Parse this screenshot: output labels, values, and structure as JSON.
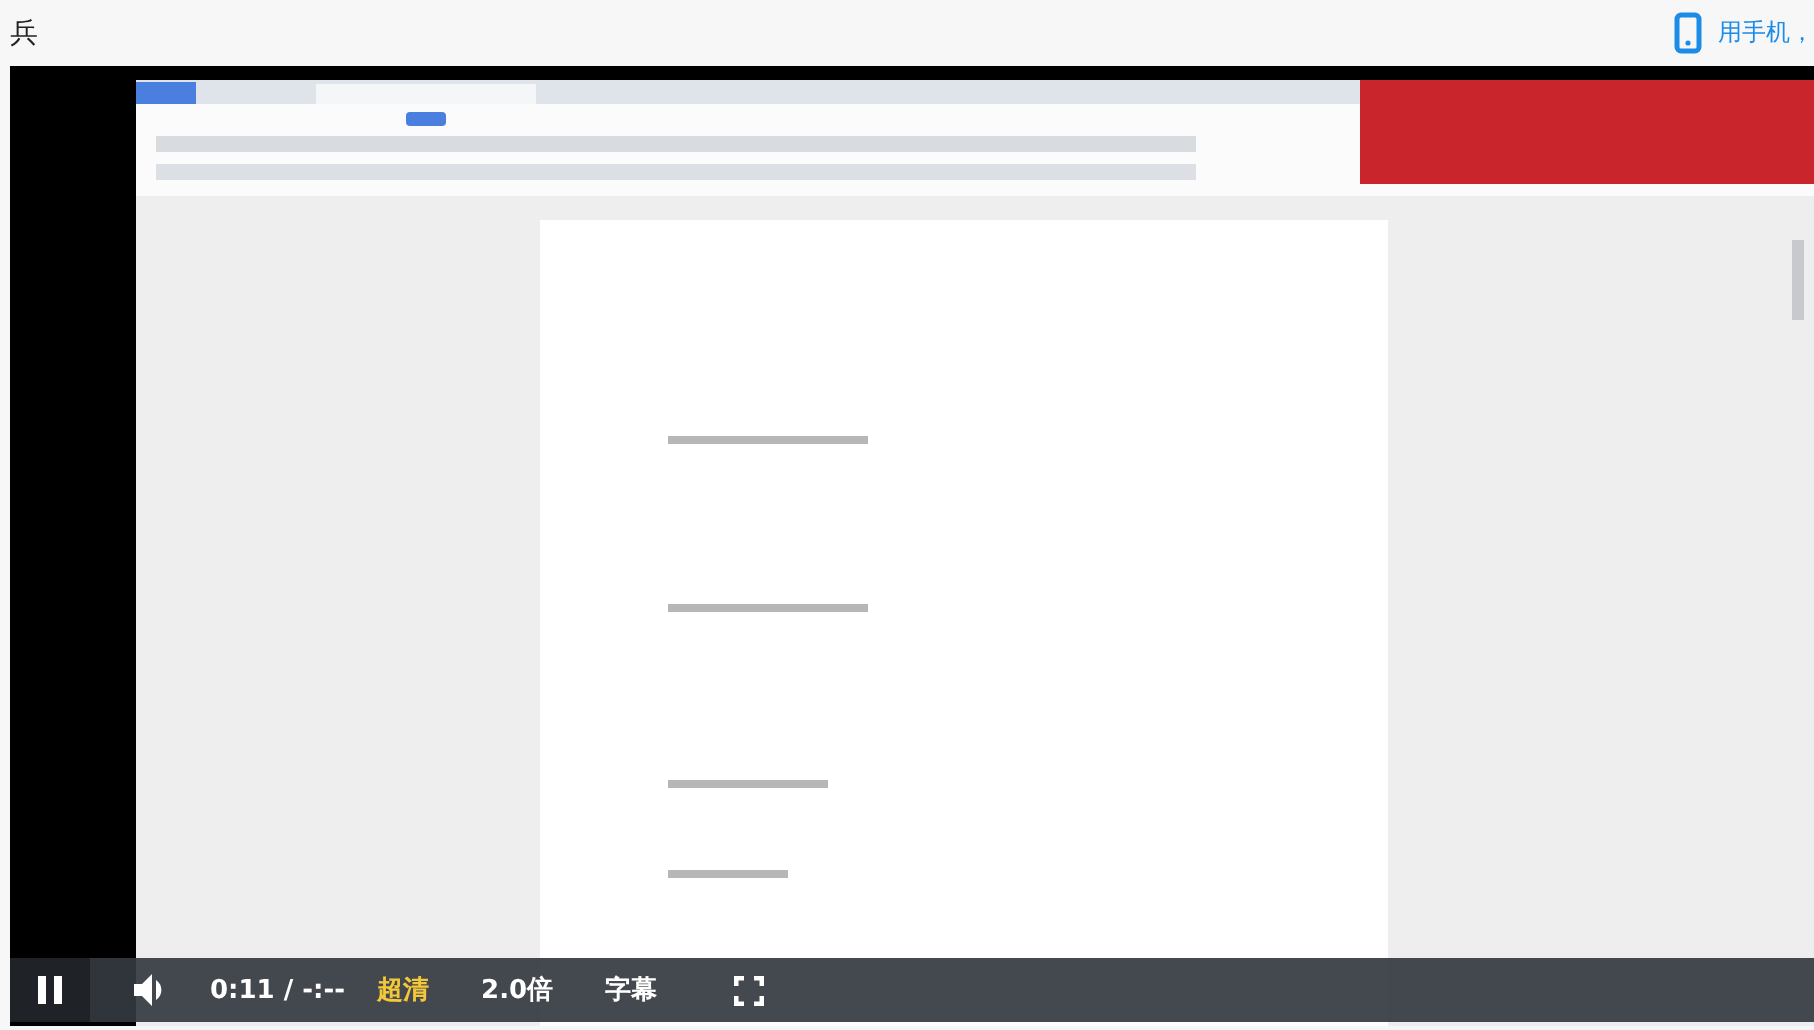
{
  "page": {
    "title": "兵"
  },
  "header_link": {
    "label": "用手机，"
  },
  "player": {
    "playing": true,
    "time": "0:11 / -:--",
    "quality": "超清",
    "speed": "2.0倍",
    "subtitles": "字幕"
  }
}
